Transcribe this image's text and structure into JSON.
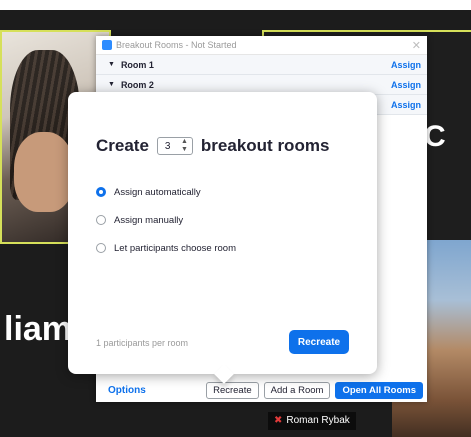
{
  "background": {
    "left_text": "liam",
    "right_text": "y C",
    "participant_name": "Roman Rybak"
  },
  "breakout_window": {
    "title": "Breakout Rooms - Not Started",
    "rooms": [
      {
        "label": "Room 1",
        "action": "Assign"
      },
      {
        "label": "Room 2",
        "action": "Assign"
      },
      {
        "label": "",
        "action": "Assign"
      }
    ],
    "footer": {
      "options": "Options",
      "recreate": "Recreate",
      "add_room": "Add a Room",
      "open_all": "Open All Rooms"
    }
  },
  "create_dialog": {
    "create_label": "Create",
    "room_count": "3",
    "suffix_label": "breakout rooms",
    "options": [
      {
        "label": "Assign automatically",
        "selected": true
      },
      {
        "label": "Assign manually",
        "selected": false
      },
      {
        "label": "Let participants choose room",
        "selected": false
      }
    ],
    "per_room_text": "1 participants per room",
    "recreate_button": "Recreate"
  },
  "colors": {
    "accent": "#0e71eb",
    "active_speaker_border": "#d6e05a"
  }
}
